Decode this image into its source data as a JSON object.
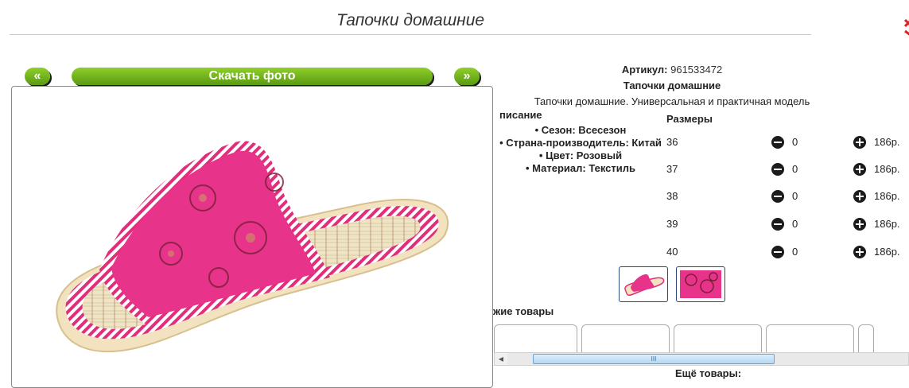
{
  "header": {
    "title": "Тапочки домашние"
  },
  "nav": {
    "prev_label": "«",
    "download_label": "Скачать фото",
    "next_label": "»"
  },
  "product": {
    "article_label": "Артикул:",
    "article_value": "961533472",
    "name": "Тапочки домашние",
    "short_desc": "Тапочки домашние. Универсальная и практичная модель"
  },
  "description": {
    "title": "писание",
    "features": [
      "Сезон: Всесезон",
      "Страна-производитель: Китай",
      "Цвет: Розовый",
      "Материал: Текстиль"
    ]
  },
  "sizes": {
    "title": "Размеры",
    "rows": [
      {
        "size": "36",
        "qty": "0",
        "price": "186р."
      },
      {
        "size": "37",
        "qty": "0",
        "price": "186р."
      },
      {
        "size": "38",
        "qty": "0",
        "price": "186р."
      },
      {
        "size": "39",
        "qty": "0",
        "price": "186р."
      },
      {
        "size": "40",
        "qty": "0",
        "price": "186р."
      }
    ]
  },
  "similar": {
    "title": "жие товары",
    "scroll_grip": "III"
  },
  "more": {
    "title": "Ещё товары:"
  },
  "colors": {
    "accent": "#6fb21c",
    "product_pink": "#e8338a"
  },
  "icons": {
    "minus": "minus-circle-icon",
    "plus": "plus-circle-icon"
  }
}
